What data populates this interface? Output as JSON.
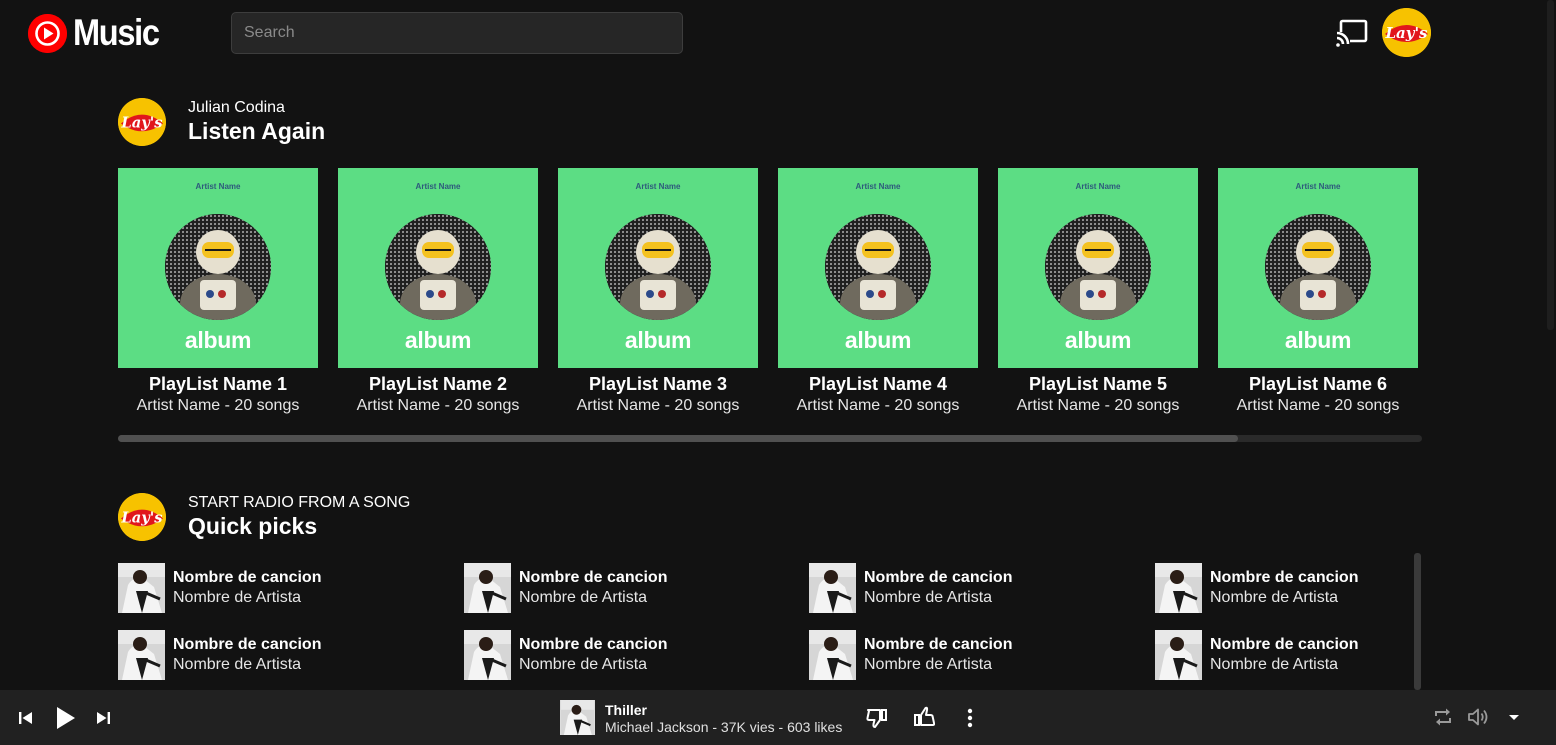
{
  "app": {
    "logo_text": "Music",
    "search_placeholder": "Search"
  },
  "listen_again": {
    "user": "Julian Codina",
    "title": "Listen Again",
    "cards": [
      {
        "cover_artist": "Artist Name",
        "cover_word": "album",
        "title": "PlayList Name 1",
        "subtitle": "Artist Name - 20 songs"
      },
      {
        "cover_artist": "Artist Name",
        "cover_word": "album",
        "title": "PlayList Name 2",
        "subtitle": "Artist Name - 20 songs"
      },
      {
        "cover_artist": "Artist Name",
        "cover_word": "album",
        "title": "PlayList Name 3",
        "subtitle": "Artist Name - 20 songs"
      },
      {
        "cover_artist": "Artist Name",
        "cover_word": "album",
        "title": "PlayList Name 4",
        "subtitle": "Artist Name - 20 songs"
      },
      {
        "cover_artist": "Artist Name",
        "cover_word": "album",
        "title": "PlayList Name 5",
        "subtitle": "Artist Name - 20 songs"
      },
      {
        "cover_artist": "Artist Name",
        "cover_word": "album",
        "title": "PlayList Name 6",
        "subtitle": "Artist Name - 20 songs"
      }
    ]
  },
  "quick_picks": {
    "subtitle": "START RADIO FROM A SONG",
    "title": "Quick picks",
    "items": [
      {
        "song": "Nombre de cancion",
        "artist": "Nombre de Artista"
      },
      {
        "song": "Nombre de cancion",
        "artist": "Nombre de Artista"
      },
      {
        "song": "Nombre de cancion",
        "artist": "Nombre de Artista"
      },
      {
        "song": "Nombre de cancion",
        "artist": "Nombre de Artista"
      },
      {
        "song": "Nombre de cancion",
        "artist": "Nombre de Artista"
      },
      {
        "song": "Nombre de cancion",
        "artist": "Nombre de Artista"
      },
      {
        "song": "Nombre de cancion",
        "artist": "Nombre de Artista"
      },
      {
        "song": "Nombre de cancion",
        "artist": "Nombre de Artista"
      }
    ]
  },
  "player": {
    "title": "Thiller",
    "meta": "Michael Jackson - 37K vies - 603 likes",
    "icons": [
      "skip-previous-icon",
      "play-icon",
      "skip-next-icon",
      "thumbs-down-icon",
      "thumbs-up-icon",
      "more-vert-icon",
      "repeat-icon",
      "volume-icon",
      "expand-icon"
    ]
  },
  "colors": {
    "background": "#121212",
    "player_bar": "#212121",
    "cover_green": "#5cdd84",
    "brand_red": "#ff0000",
    "avatar_yellow": "#f7c200"
  }
}
